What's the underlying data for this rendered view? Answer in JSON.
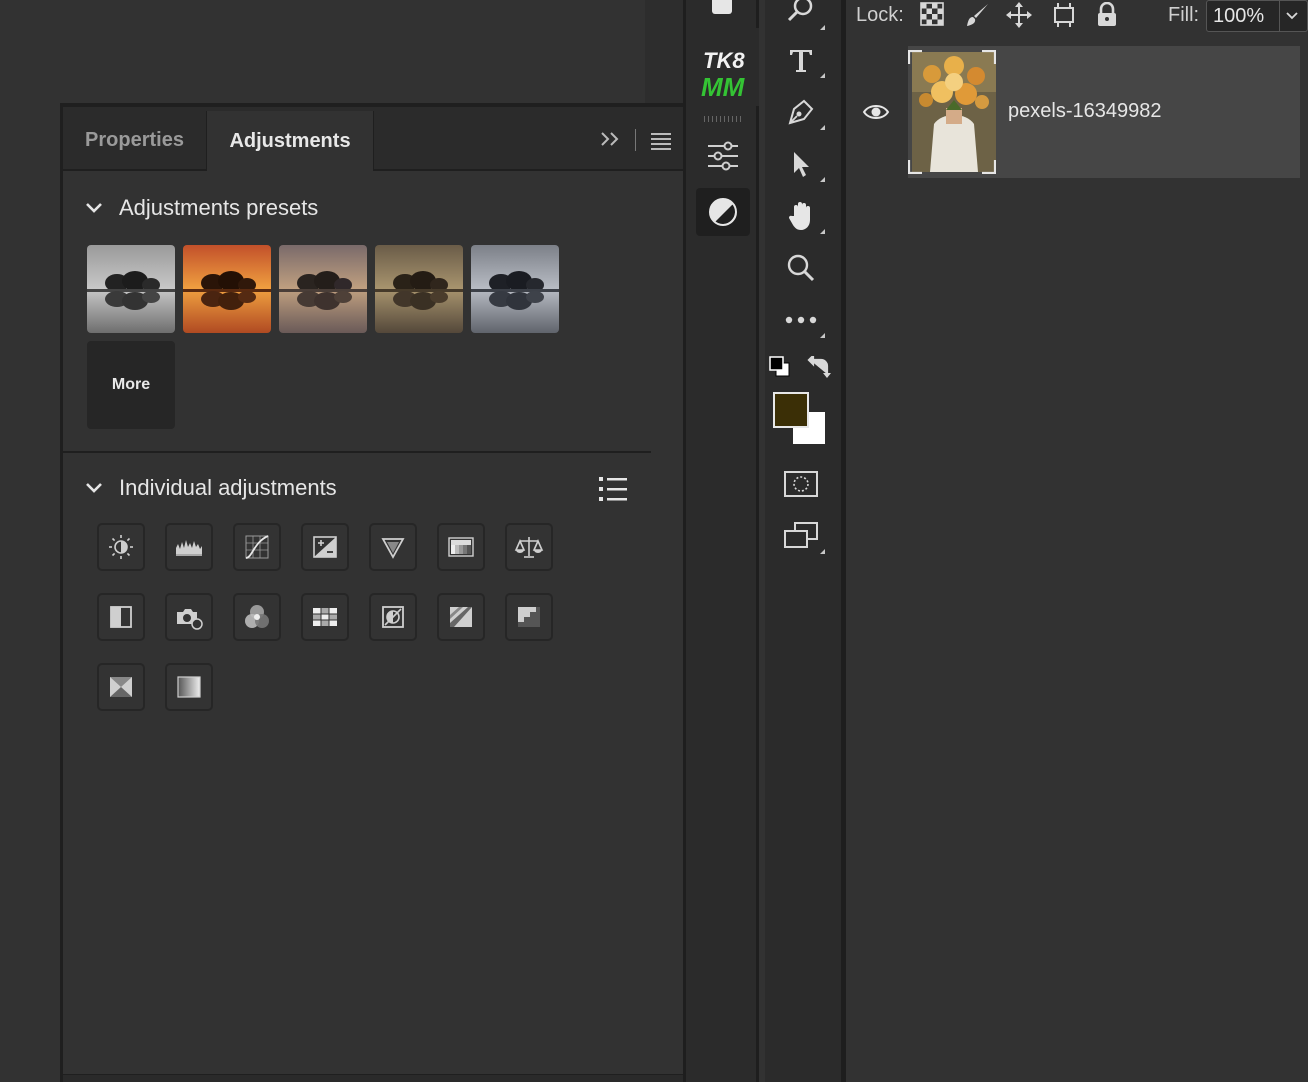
{
  "properties_panel": {
    "tabs": [
      {
        "label": "Properties",
        "active": false
      },
      {
        "label": "Adjustments",
        "active": true
      }
    ],
    "presets_section": {
      "title": "Adjustments presets",
      "more_label": "More",
      "presets": [
        {
          "name": "preset-bw",
          "tone": "grayscale"
        },
        {
          "name": "preset-sunset",
          "tone": "orange"
        },
        {
          "name": "preset-warm-fade",
          "tone": "muted-warm"
        },
        {
          "name": "preset-sepia",
          "tone": "sepia"
        },
        {
          "name": "preset-cool",
          "tone": "cool-gray"
        }
      ]
    },
    "individual_section": {
      "title": "Individual adjustments",
      "items": [
        "brightness-contrast-icon",
        "levels-icon",
        "curves-icon",
        "exposure-icon",
        "vibrance-icon",
        "hue-saturation-icon",
        "color-balance-icon",
        "black-white-icon",
        "photo-filter-icon",
        "channel-mixer-icon",
        "color-lookup-icon",
        "invert-icon",
        "posterize-icon",
        "threshold-icon",
        "selective-color-icon",
        "gradient-map-icon"
      ]
    }
  },
  "dock": {
    "logo_top": "TK8",
    "logo_bottom": "MM",
    "logo_bottom_color": "#34c334"
  },
  "tools": {
    "foreground_color": "#3b2f06",
    "background_color": "#ffffff",
    "items": [
      "zoom-icon",
      "type-tool-icon",
      "pen-tool-icon",
      "path-selection-icon",
      "hand-tool-icon",
      "zoom-tool-icon",
      "more-tools-icon",
      "quick-mask-icon",
      "screen-mode-icon"
    ]
  },
  "layers_panel": {
    "lock_label": "Lock:",
    "fill_label": "Fill:",
    "fill_value": "100%",
    "layers": [
      {
        "name": "pexels-16349982",
        "visible": true,
        "selected": true
      }
    ]
  }
}
